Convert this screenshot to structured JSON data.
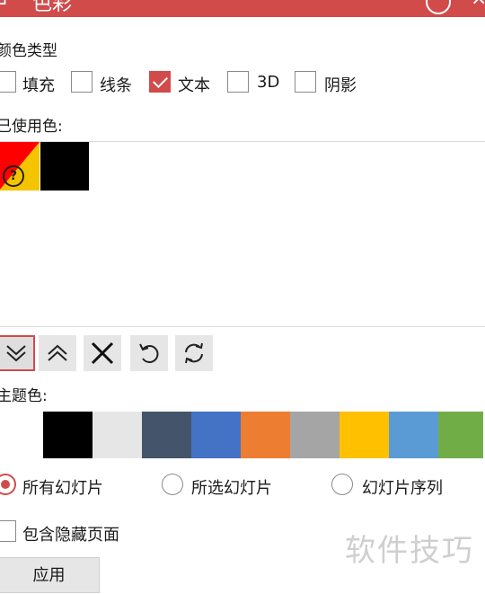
{
  "titlebar": {
    "title_glyph": "色彩",
    "accent": "#d14b4b"
  },
  "color_type": {
    "label": "颜色类型",
    "options": [
      {
        "label": "填充",
        "checked": false
      },
      {
        "label": "线条",
        "checked": false
      },
      {
        "label": "文本",
        "checked": true
      },
      {
        "label": "3D",
        "checked": false
      },
      {
        "label": "阴影",
        "checked": false
      }
    ]
  },
  "used_colors": {
    "label": "已使用色:",
    "swatches": [
      "mixed",
      "#000000"
    ],
    "unknown_glyph": "?"
  },
  "toolbar": {
    "icons": [
      "chevron-down-double-icon",
      "chevron-up-double-icon",
      "close-icon",
      "undo-icon",
      "refresh-icon"
    ]
  },
  "theme_colors": {
    "label": "主题色:",
    "swatches": [
      "#ffffff",
      "#000000",
      "#e7e6e6",
      "#44546a",
      "#4472c4",
      "#ed7d31",
      "#a5a5a5",
      "#ffc000",
      "#5b9bd5",
      "#70ad47"
    ]
  },
  "scope": {
    "options": [
      {
        "label": "所有幻灯片",
        "selected": true
      },
      {
        "label": "所选幻灯片",
        "selected": false
      },
      {
        "label": "幻灯片序列",
        "selected": false
      }
    ]
  },
  "include_hidden": {
    "label": "包含隐藏页面",
    "checked": false
  },
  "apply_button": {
    "label": "应用"
  },
  "watermark": "软件技巧"
}
